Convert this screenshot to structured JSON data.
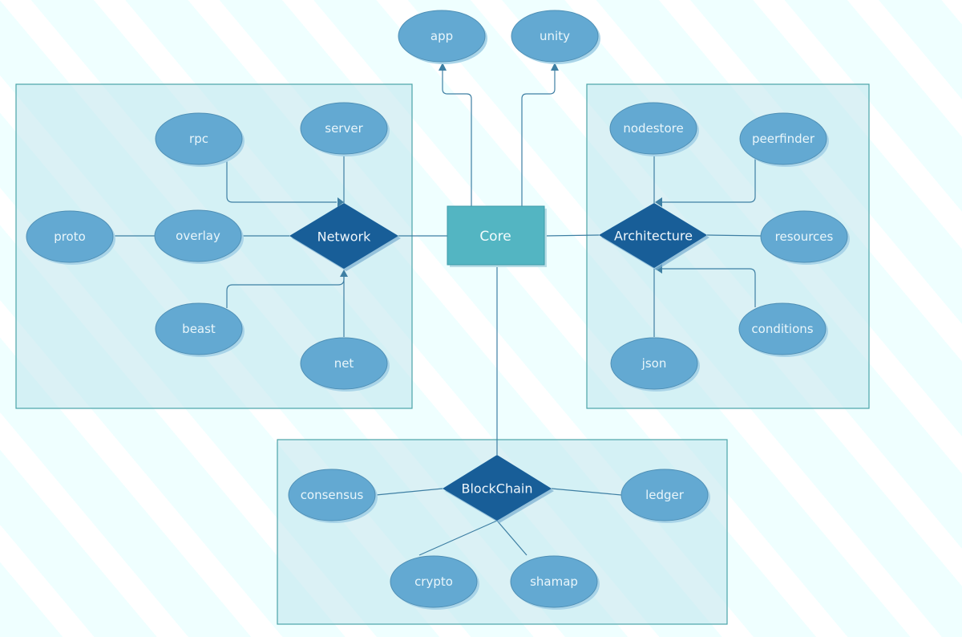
{
  "diagram": {
    "core": {
      "id": "core",
      "label": "Core"
    },
    "top_nodes": [
      {
        "id": "app",
        "label": "app"
      },
      {
        "id": "unity",
        "label": "unity"
      }
    ],
    "groups": [
      {
        "id": "network",
        "hub": {
          "id": "network",
          "label": "Network"
        },
        "nodes": [
          {
            "id": "rpc",
            "label": "rpc"
          },
          {
            "id": "server",
            "label": "server"
          },
          {
            "id": "proto",
            "label": "proto"
          },
          {
            "id": "overlay",
            "label": "overlay"
          },
          {
            "id": "beast",
            "label": "beast"
          },
          {
            "id": "net",
            "label": "net"
          }
        ]
      },
      {
        "id": "architecture",
        "hub": {
          "id": "architecture",
          "label": "Architecture"
        },
        "nodes": [
          {
            "id": "nodestore",
            "label": "nodestore"
          },
          {
            "id": "peerfinder",
            "label": "peerfinder"
          },
          {
            "id": "resources",
            "label": "resources"
          },
          {
            "id": "conditions",
            "label": "conditions"
          },
          {
            "id": "json",
            "label": "json"
          }
        ]
      },
      {
        "id": "blockchain",
        "hub": {
          "id": "blockchain",
          "label": "BlockChain"
        },
        "nodes": [
          {
            "id": "consensus",
            "label": "consensus"
          },
          {
            "id": "ledger",
            "label": "ledger"
          },
          {
            "id": "crypto",
            "label": "crypto"
          },
          {
            "id": "shamap",
            "label": "shamap"
          }
        ]
      }
    ],
    "edges": [
      {
        "from": "core",
        "to": "app",
        "arrow": true
      },
      {
        "from": "core",
        "to": "unity",
        "arrow": true
      },
      {
        "from": "core",
        "to": "network",
        "arrow": false
      },
      {
        "from": "core",
        "to": "architecture",
        "arrow": false
      },
      {
        "from": "core",
        "to": "blockchain",
        "arrow": false
      },
      {
        "from": "rpc",
        "to": "network",
        "arrow": true
      },
      {
        "from": "server",
        "to": "network",
        "arrow": false
      },
      {
        "from": "proto",
        "to": "overlay",
        "arrow": false
      },
      {
        "from": "overlay",
        "to": "network",
        "arrow": false
      },
      {
        "from": "beast",
        "to": "network",
        "arrow": true
      },
      {
        "from": "net",
        "to": "network",
        "arrow": true
      },
      {
        "from": "nodestore",
        "to": "architecture",
        "arrow": false
      },
      {
        "from": "peerfinder",
        "to": "architecture",
        "arrow": true
      },
      {
        "from": "resources",
        "to": "architecture",
        "arrow": false
      },
      {
        "from": "conditions",
        "to": "architecture",
        "arrow": true
      },
      {
        "from": "json",
        "to": "architecture",
        "arrow": false
      },
      {
        "from": "consensus",
        "to": "blockchain",
        "arrow": false
      },
      {
        "from": "ledger",
        "to": "blockchain",
        "arrow": false
      },
      {
        "from": "crypto",
        "to": "blockchain",
        "arrow": false
      },
      {
        "from": "shamap",
        "to": "blockchain",
        "arrow": false
      }
    ]
  }
}
